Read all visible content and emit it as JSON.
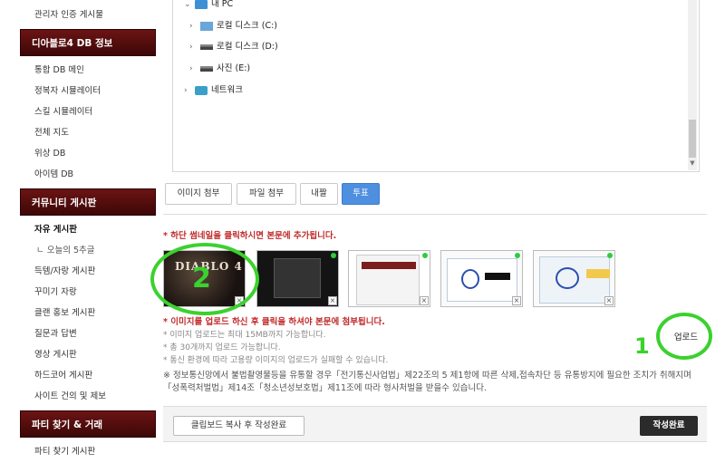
{
  "sidebar": {
    "top_item": "관리자 인증 게시물",
    "sections": [
      {
        "title": "디아블로4 DB 정보",
        "items": [
          "통합 DB 메인",
          "정복자 시뮬레이터",
          "스킬 시뮬레이터",
          "전체 지도",
          "위상 DB",
          "아이템 DB"
        ]
      },
      {
        "title": "커뮤니티 게시판",
        "items": [
          "자유 게시판",
          "ㄴ 오늘의 5추글",
          "득템/자랑 게시판",
          "꾸미기 자랑",
          "클랜 홍보 게시판",
          "질문과 답변",
          "영상 게시판",
          "하드코어 게시판",
          "사이트 건의 및 제보"
        ]
      },
      {
        "title": "파티 찾기 & 거래",
        "items": [
          "파티 찾기 게시판"
        ]
      }
    ]
  },
  "file_tree": {
    "items": [
      {
        "label": "내 PC",
        "arrow": "⌄"
      },
      {
        "label": "로컬 디스크 (C:)",
        "arrow": "›"
      },
      {
        "label": "로컬 디스크 (D:)",
        "arrow": "›"
      },
      {
        "label": "사진 (E:)",
        "arrow": "›"
      },
      {
        "label": "네트워크",
        "arrow": "›"
      }
    ]
  },
  "tabs": [
    "이미지 첨부",
    "파일 첨부",
    "내짤",
    "투표"
  ],
  "notes": {
    "thumbnail_hint": "* 하단 썸네일을 클릭하시면 본문에 추가됩니다.",
    "upload_hint": "* 이미지를 업로드 하신 후 클릭을 하셔야 본문에 첨부됩니다.",
    "limits": [
      "* 이미지 업로드는 최대 15MB까지 가능합니다.",
      "* 총 30개까지 업로드 가능합니다.",
      "* 통신 환경에 따라 고용량 이미지의 업로드가 실패할 수 있습니다."
    ]
  },
  "thumbnails": {
    "t1_logo": "DIABLO 4",
    "remove_glyph": "×"
  },
  "annotations": {
    "number_2": "2",
    "number_1": "1",
    "color": "#3bd12e"
  },
  "upload_button": "업로드",
  "legal_text": "※ 정보통신망에서 불법촬영물등을 유통할 경우「전기통신사업법」제22조의 5 제1항에 따른 삭제,접속차단 등 유통방지에 필요한 조치가 취해지며「성폭력처벌법」제14조「청소년성보호법」제11조에 따라 형사처벌을 받을수 있습니다.",
  "footer": {
    "clipboard_button": "클립보드 복사 후 작성완료",
    "submit_button": "작성완료"
  }
}
